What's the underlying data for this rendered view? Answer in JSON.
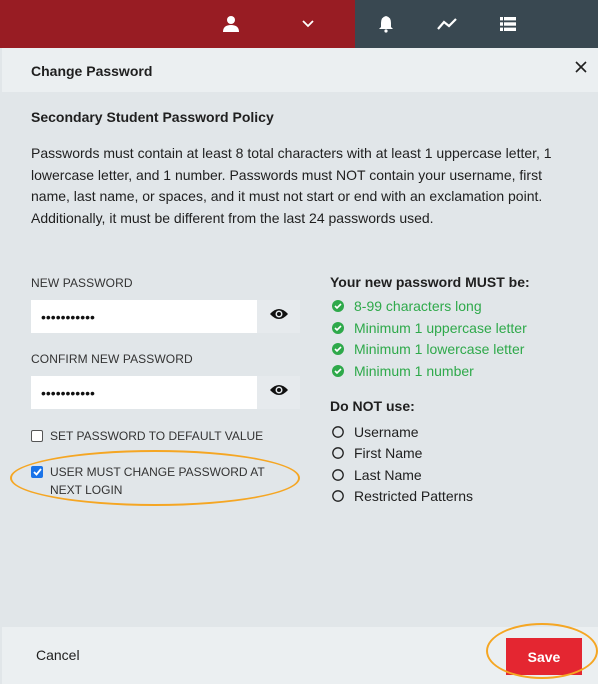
{
  "topbar": {
    "icons": [
      "user-icon",
      "chevron-down-icon",
      "bell-icon",
      "trend-line-icon",
      "list-icon"
    ]
  },
  "dialog": {
    "title": "Change Password",
    "policy": {
      "title": "Secondary Student Password Policy",
      "text": "Passwords must contain at least 8 total characters with at least 1 uppercase letter, 1 lowercase letter, and 1 number. Passwords must NOT contain your username, first name, last name, or spaces, and it must not start or end with an exclamation point. Additionally, it must be different from the last 24 passwords used."
    },
    "new_password": {
      "label": "NEW PASSWORD",
      "value": "•••••••••••"
    },
    "confirm_password": {
      "label": "CONFIRM NEW PASSWORD",
      "value": "•••••••••••"
    },
    "checkboxes": [
      {
        "label": "SET PASSWORD TO DEFAULT VALUE",
        "checked": false
      },
      {
        "label": "USER MUST CHANGE PASSWORD AT NEXT LOGIN",
        "checked": true
      }
    ],
    "requirements": {
      "must_title": "Your new password MUST be:",
      "must": [
        "8-99 characters long",
        "Minimum 1 uppercase letter",
        "Minimum 1 lowercase letter",
        "Minimum 1 number"
      ],
      "not_title": "Do NOT use:",
      "not": [
        "Username",
        "First Name",
        "Last Name",
        "Restricted Patterns"
      ]
    },
    "footer": {
      "cancel": "Cancel",
      "save": "Save"
    }
  },
  "colors": {
    "brand_red": "#981c23",
    "nav_dark": "#394851",
    "save_red": "#e42631",
    "ok_green": "#2ea94a",
    "highlight": "#f5a623"
  }
}
